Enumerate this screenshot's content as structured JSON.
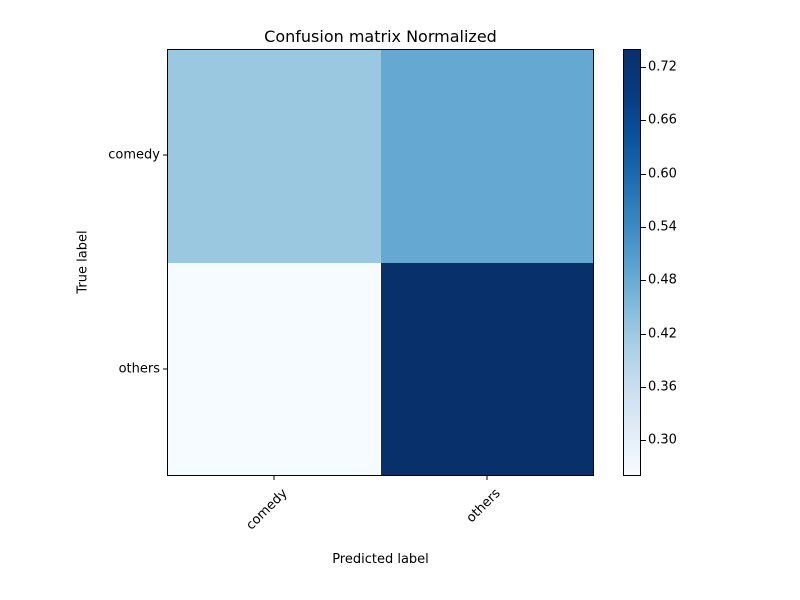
{
  "title": "Confusion matrix Normalized",
  "xlabel": "Predicted label",
  "ylabel": "True label",
  "categories": [
    "comedy",
    "others"
  ],
  "colorbar_ticks": [
    "0.30",
    "0.36",
    "0.42",
    "0.48",
    "0.54",
    "0.60",
    "0.66",
    "0.72"
  ],
  "chart_data": {
    "type": "heatmap",
    "title": "Confusion matrix Normalized",
    "xlabel": "Predicted label",
    "ylabel": "True label",
    "x_categories": [
      "comedy",
      "others"
    ],
    "y_categories": [
      "comedy",
      "others"
    ],
    "values": [
      [
        0.46,
        0.54
      ],
      [
        0.26,
        0.74
      ]
    ],
    "colorscale": "Blues",
    "colorbar": {
      "min": 0.26,
      "max": 0.74,
      "ticks": [
        0.3,
        0.36,
        0.42,
        0.48,
        0.54,
        0.6,
        0.66,
        0.72
      ]
    },
    "cell_colors": {
      "0,0": "#9bc8e1",
      "0,1": "#65a8d2",
      "1,0": "#f6fbff",
      "1,1": "#08306b"
    }
  }
}
